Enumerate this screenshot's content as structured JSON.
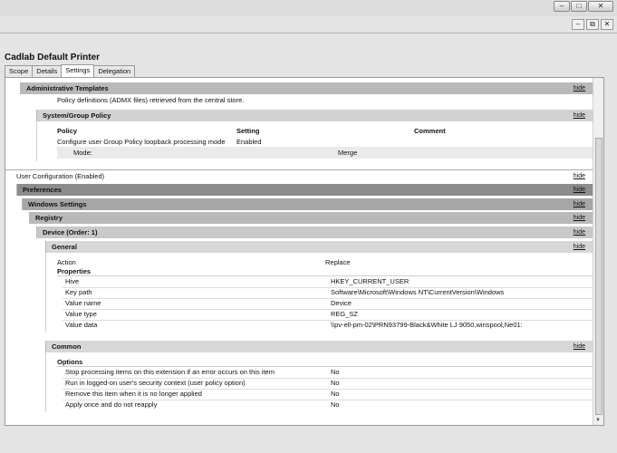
{
  "window": {
    "minimize": "–",
    "maximize": "□",
    "close": "✕",
    "inner_min": "–",
    "inner_restore": "⧉",
    "inner_close": "✕"
  },
  "gpo": {
    "title": "Cadlab Default Printer",
    "tabs": [
      "Scope",
      "Details",
      "Settings",
      "Delegation"
    ],
    "active_tab": "Settings"
  },
  "hide_label": "hide",
  "admin_templates": {
    "title": "Administrative Templates",
    "note": "Policy definitions (ADMX files) retrieved from the central store."
  },
  "system_group_policy": {
    "title": "System/Group Policy",
    "headers": [
      "Policy",
      "Setting",
      "Comment"
    ],
    "policy_name": "Configure user Group Policy loopback processing mode",
    "policy_setting": "Enabled",
    "mode_label": "Mode:",
    "mode_value": "Merge"
  },
  "user_config": {
    "title": "User Configuration (Enabled)"
  },
  "preferences": {
    "title": "Preferences"
  },
  "windows_settings": {
    "title": "Windows Settings"
  },
  "registry": {
    "title": "Registry"
  },
  "device": {
    "title": "Device (Order: 1)"
  },
  "general": {
    "title": "General",
    "action_label": "Action",
    "action_value": "Replace",
    "properties_title": "Properties",
    "properties": [
      {
        "label": "Hive",
        "value": "HKEY_CURRENT_USER"
      },
      {
        "label": "Key path",
        "value": "Software\\Microsoft\\Windows NT\\CurrentVersion\\Windows"
      },
      {
        "label": "Value name",
        "value": "Device"
      },
      {
        "label": "Value type",
        "value": "REG_SZ"
      },
      {
        "label": "Value data",
        "value": "\\\\pv-ell-pm-02\\PRN93799-Black&White LJ 9050,winspool,Ne01:"
      }
    ]
  },
  "common": {
    "title": "Common",
    "options_title": "Options",
    "options": [
      {
        "label": "Stop processing items on this extension if an error occurs on this item",
        "value": "No"
      },
      {
        "label": "Run in logged-on user's security context (user policy option)",
        "value": "No"
      },
      {
        "label": "Remove this item when it is no longer applied",
        "value": "No"
      },
      {
        "label": "Apply once and do not reapply",
        "value": "No"
      }
    ]
  }
}
